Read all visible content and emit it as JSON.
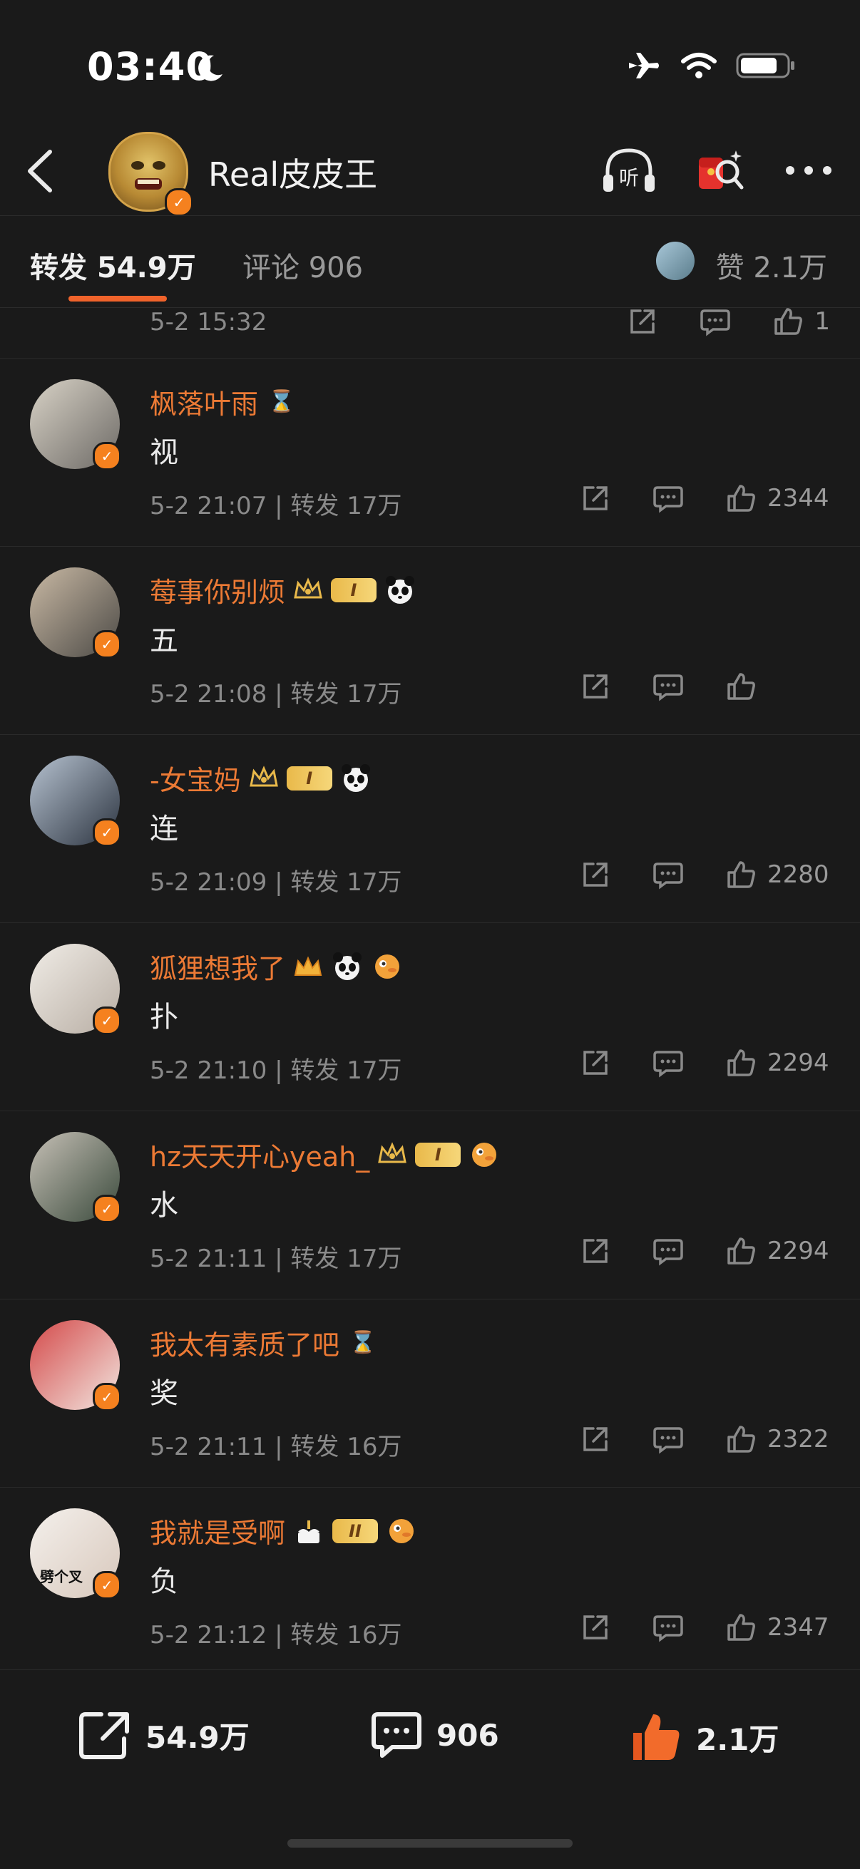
{
  "status_bar": {
    "time": "03:40"
  },
  "header": {
    "user_name": "Real皮皮王",
    "listen_label": "听"
  },
  "tabs": {
    "repost_label": "转发",
    "repost_count": "54.9万",
    "comments_label": "评论",
    "comments_count": "906",
    "likes_label": "赞",
    "likes_count": "2.1万"
  },
  "partial_row": {
    "meta": "5-2 15:32",
    "likes": "1"
  },
  "comments": [
    {
      "user": "枫落叶雨",
      "text": "视",
      "meta": "5-2 21:07 | 转发 17万",
      "likes": "2344"
    },
    {
      "user": "莓事你别烦",
      "text": "五",
      "meta": "5-2 21:08 | 转发 17万",
      "likes": ""
    },
    {
      "user": "-女宝妈",
      "text": "连",
      "meta": "5-2 21:09 | 转发 17万",
      "likes": "2280"
    },
    {
      "user": "狐狸想我了",
      "text": "扑",
      "meta": "5-2 21:10 | 转发 17万",
      "likes": "2294"
    },
    {
      "user": "hz天天开心yeah_",
      "text": "水",
      "meta": "5-2 21:11 | 转发 17万",
      "likes": "2294"
    },
    {
      "user": "我太有素质了吧",
      "text": "奖",
      "meta": "5-2 21:11 | 转发 16万",
      "likes": "2322"
    },
    {
      "user": "我就是受啊",
      "text": "负",
      "meta": "5-2 21:12 | 转发 16万",
      "likes": "2347",
      "avatar_caption": "劈个叉"
    }
  ],
  "badges": {
    "level_1": "I",
    "level_2": "II"
  },
  "bottom_bar": {
    "repost": "54.9万",
    "comment": "906",
    "like": "2.1万"
  },
  "colors": {
    "accent": "#f0632b",
    "username": "#ec7a35",
    "verified": "#f5811f"
  }
}
